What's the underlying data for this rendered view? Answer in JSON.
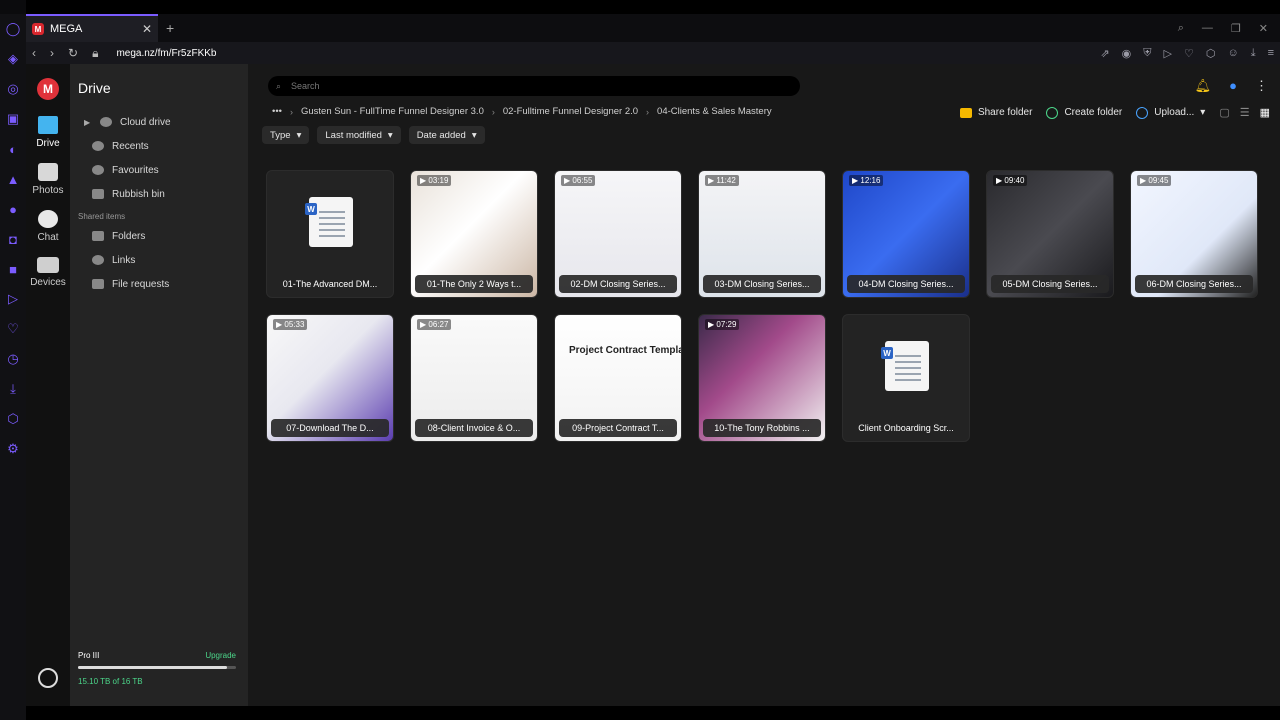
{
  "browser": {
    "tab_title": "MEGA",
    "tab_favicon": "M",
    "url": "mega.nz/fm/Fr5zFKKb"
  },
  "app": {
    "logo": "M",
    "rail": [
      {
        "label": "Drive",
        "icon": "folder-icon"
      },
      {
        "label": "Photos",
        "icon": "photos-icon"
      },
      {
        "label": "Chat",
        "icon": "chat-icon"
      },
      {
        "label": "Devices",
        "icon": "devices-icon"
      }
    ]
  },
  "sidebar": {
    "title": "Drive",
    "items": [
      {
        "label": "Cloud drive",
        "icon": "cloud-icon"
      },
      {
        "label": "Recents",
        "icon": "clock-icon"
      },
      {
        "label": "Favourites",
        "icon": "heart-icon"
      },
      {
        "label": "Rubbish bin",
        "icon": "trash-icon"
      }
    ],
    "shared_section": "Shared items",
    "shared_items": [
      {
        "label": "Folders",
        "icon": "shared-folder-icon"
      },
      {
        "label": "Links",
        "icon": "link-icon"
      },
      {
        "label": "File requests",
        "icon": "file-request-icon"
      }
    ],
    "storage": {
      "plan": "Pro III",
      "upgrade": "Upgrade",
      "used_text": "15.10 TB of 16 TB",
      "used_fraction": 0.94
    }
  },
  "main": {
    "search_placeholder": "Search",
    "breadcrumbs": [
      "•••",
      "Gusten Sun - FullTime Funnel Designer 3.0",
      "02-Fulltime Funnel Designer 2.0",
      "04-Clients & Sales Mastery"
    ],
    "actions": {
      "share_folder": "Share folder",
      "create_folder": "Create folder",
      "upload": "Upload..."
    },
    "filters": [
      "Type",
      "Last modified",
      "Date added"
    ],
    "files": [
      {
        "name": "01-The Advanced DM...",
        "duration": "",
        "kind": "doc"
      },
      {
        "name": "01-The Only 2 Ways t...",
        "duration": "03:19",
        "kind": "video"
      },
      {
        "name": "02-DM Closing Series...",
        "duration": "06:55",
        "kind": "video"
      },
      {
        "name": "03-DM Closing Series...",
        "duration": "11:42",
        "kind": "video"
      },
      {
        "name": "04-DM Closing Series...",
        "duration": "12:16",
        "kind": "video"
      },
      {
        "name": "05-DM Closing Series...",
        "duration": "09:40",
        "kind": "video"
      },
      {
        "name": "06-DM Closing Series...",
        "duration": "09:45",
        "kind": "video"
      },
      {
        "name": "07-Download The D...",
        "duration": "05:33",
        "kind": "video"
      },
      {
        "name": "08-Client Invoice & O...",
        "duration": "06:27",
        "kind": "video"
      },
      {
        "name": "09-Project Contract T...",
        "duration": "",
        "kind": "video",
        "thumb_title": "Project Contract Template"
      },
      {
        "name": "10-The Tony Robbins ...",
        "duration": "07:29",
        "kind": "video"
      },
      {
        "name": "Client Onboarding Scr...",
        "duration": "",
        "kind": "doc"
      }
    ]
  },
  "colors": {
    "accent": "#7b5cff",
    "mega_red": "#e0323a",
    "green": "#4cd68a"
  }
}
